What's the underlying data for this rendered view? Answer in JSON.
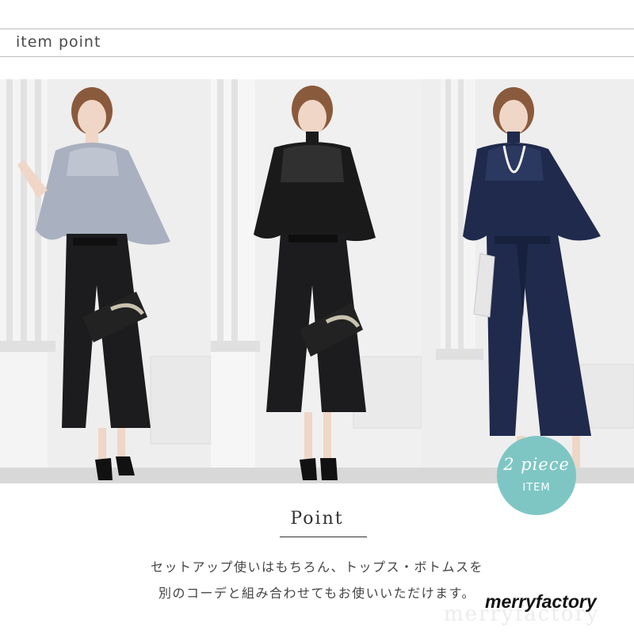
{
  "header": {
    "title": "item point"
  },
  "badge": {
    "script_text": "2 piece",
    "sub_text": "ITEM",
    "color": "#7ec6c4"
  },
  "point": {
    "title": "Point",
    "line1": "セットアップ使いはもちろん、トップス・ボトムスを",
    "line2": "別のコーデと組み合わせてもお使いいただけます。"
  },
  "brand": "merryfactory",
  "watermark": "merryfactory",
  "photos": [
    {
      "name": "model-gray-top",
      "top_color": "#a9b0c0",
      "bottom_color": "#1c1c1e"
    },
    {
      "name": "model-black-top",
      "top_color": "#1a1a1a",
      "bottom_color": "#1c1c1e"
    },
    {
      "name": "model-navy-top",
      "top_color": "#1f2a4d",
      "bottom_color": "#1f2a4d"
    }
  ]
}
